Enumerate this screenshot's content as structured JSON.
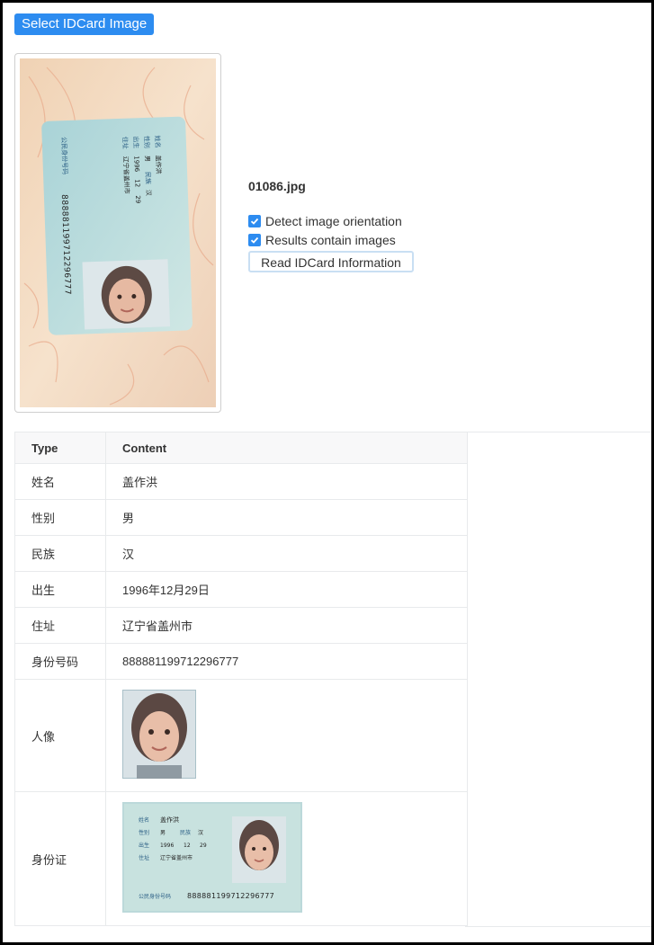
{
  "toolbar": {
    "select_label": "Select IDCard Image"
  },
  "preview": {
    "filename": "01086.jpg",
    "card_text": {
      "name_label": "姓名",
      "name": "盖作洪",
      "sex_label": "性别",
      "sex": "男",
      "ethnic_label": "民族",
      "ethnic": "汉",
      "birth_label": "出生",
      "birth_year": "1996",
      "birth_month": "12",
      "birth_day": "29",
      "addr_label": "住址",
      "addr": "辽宁省盖州市",
      "id_label": "公民身份号码",
      "id_number": "888881199712296777"
    }
  },
  "options": {
    "detect_orientation": {
      "label": "Detect image orientation",
      "checked": true
    },
    "results_images": {
      "label": "Results contain images",
      "checked": true
    }
  },
  "read_button_label": "Read IDCard Information",
  "table": {
    "headers": {
      "type": "Type",
      "content": "Content"
    },
    "rows": [
      {
        "type": "姓名",
        "content": "盖作洪"
      },
      {
        "type": "性别",
        "content": "男"
      },
      {
        "type": "民族",
        "content": "汉"
      },
      {
        "type": "出生",
        "content": "1996年12月29日"
      },
      {
        "type": "住址",
        "content": "辽宁省盖州市"
      },
      {
        "type": "身份号码",
        "content": "888881199712296777"
      },
      {
        "type": "人像"
      },
      {
        "type": "身份证"
      }
    ]
  },
  "colors": {
    "accent": "#2d8cf0",
    "card": "#b9dce0",
    "background_fabric": "#f3d9be"
  }
}
